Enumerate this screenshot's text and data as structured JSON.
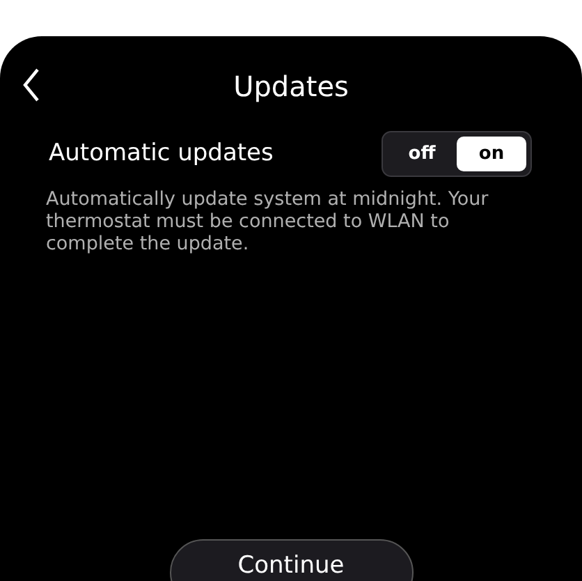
{
  "header": {
    "title": "Updates"
  },
  "setting": {
    "label": "Automatic updates",
    "options": [
      {
        "label": "off",
        "selected": false
      },
      {
        "label": "on",
        "selected": true
      }
    ],
    "description": "Automatically update system at midnight. Your thermostat must be connected to WLAN to complete the update."
  },
  "button": {
    "label": "Continue"
  }
}
